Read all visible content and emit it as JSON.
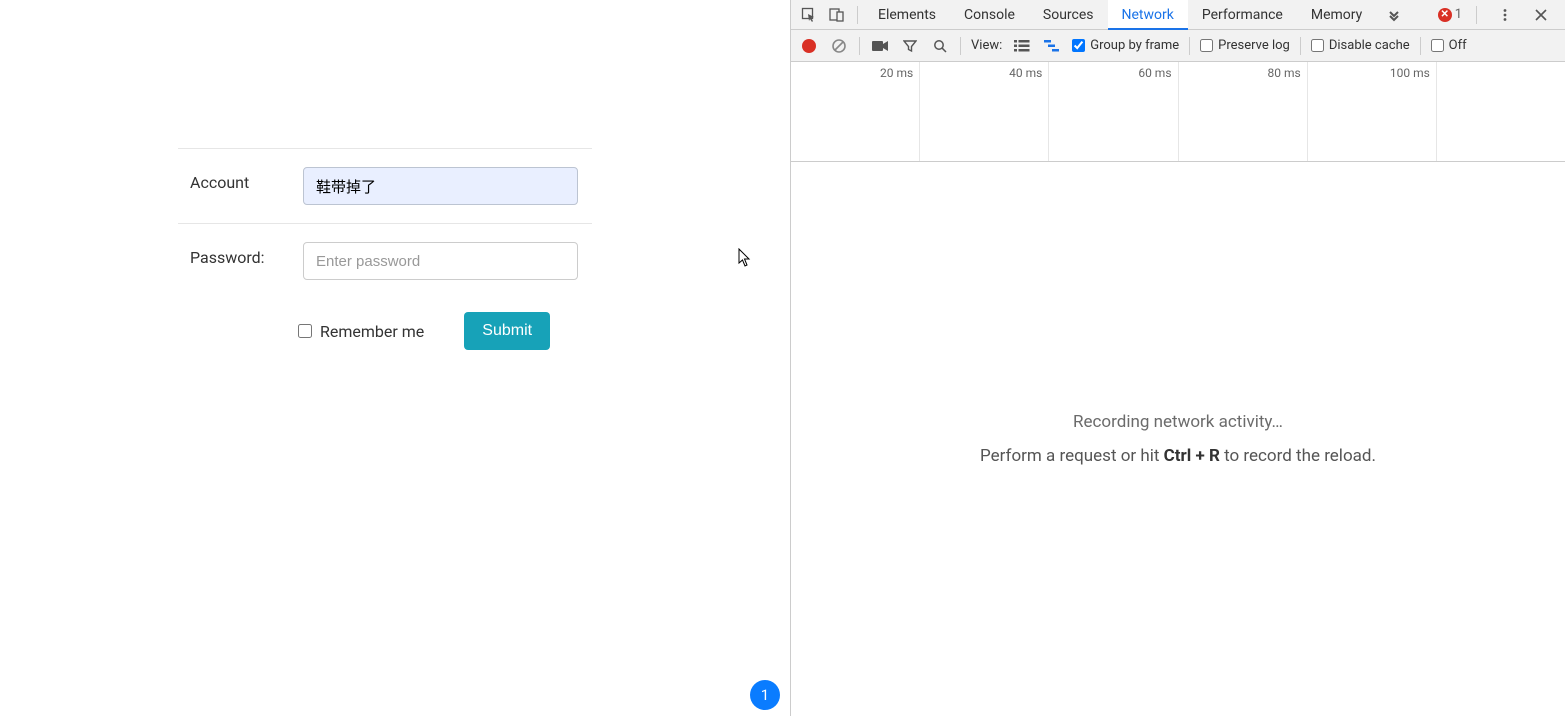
{
  "form": {
    "account_label": "Account",
    "account_value": "鞋带掉了",
    "password_label": "Password:",
    "password_placeholder": "Enter password",
    "remember_label": "Remember me",
    "submit_label": "Submit"
  },
  "badge": {
    "count": "1"
  },
  "devtools": {
    "tabs": {
      "elements": "Elements",
      "console": "Console",
      "sources": "Sources",
      "network": "Network",
      "performance": "Performance",
      "memory": "Memory"
    },
    "error_count": "1",
    "toolbar": {
      "view_label": "View:",
      "group_by_frame": "Group by frame",
      "preserve_log": "Preserve log",
      "disable_cache": "Disable cache",
      "offline": "Off"
    },
    "timeline": {
      "ticks": [
        "20 ms",
        "40 ms",
        "60 ms",
        "80 ms",
        "100 ms"
      ]
    },
    "empty": {
      "line1": "Recording network activity…",
      "line2a": "Perform a request or hit ",
      "kbd": "Ctrl + R",
      "line2b": " to record the reload."
    }
  }
}
